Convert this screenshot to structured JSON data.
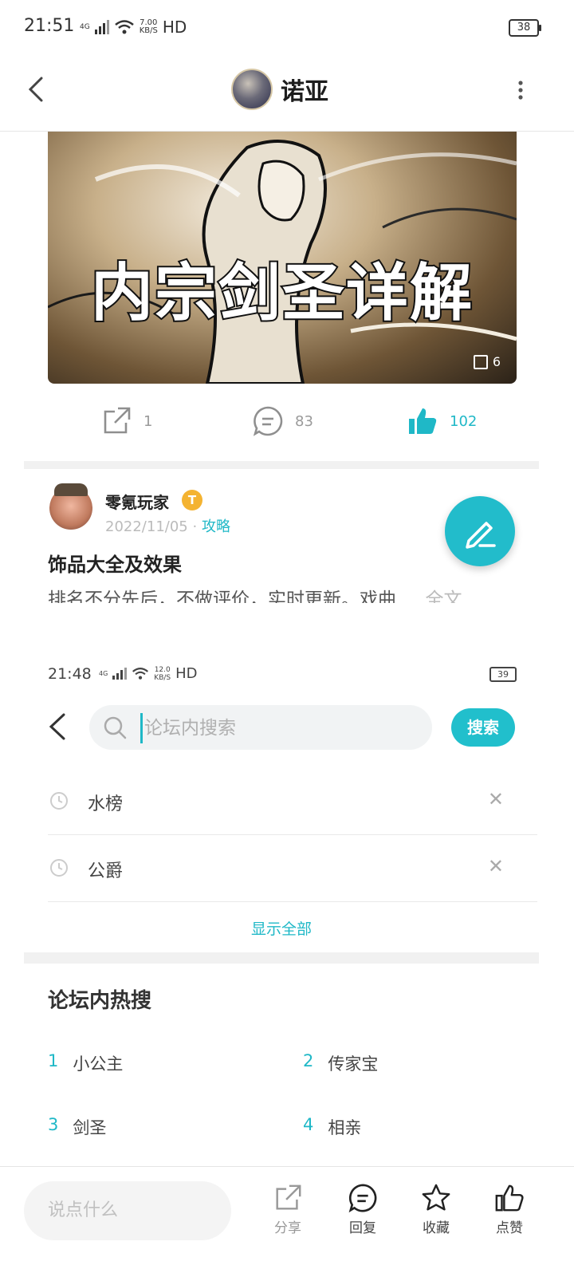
{
  "status_bar": {
    "time": "21:51",
    "network": "4G",
    "speed_value": "7.00",
    "speed_unit": "KB/S",
    "hd": "HD",
    "battery": "38"
  },
  "header": {
    "title": "诺亚"
  },
  "banner": {
    "title": "内宗剑圣详解",
    "image_count": "6"
  },
  "actions": {
    "share_count": "1",
    "comment_count": "83",
    "like_count": "102"
  },
  "post": {
    "author": "零氪玩家",
    "badge": "T",
    "date": "2022/11/05",
    "separator": "·",
    "tag": "攻略",
    "title": "饰品大全及效果",
    "excerpt": "排名不分先后，不做评价，实时更新。戏曲",
    "more": "... 全文"
  },
  "embedded_screen": {
    "time": "21:48",
    "network": "4G",
    "speed_value": "12.0",
    "speed_unit": "KB/S",
    "hd": "HD",
    "battery": "39",
    "search_placeholder": "论坛内搜索",
    "search_button": "搜索",
    "history": [
      {
        "label": "水榜"
      },
      {
        "label": "公爵"
      }
    ],
    "show_all": "显示全部",
    "hot_title": "论坛内热搜",
    "hot": [
      {
        "rank": "1",
        "label": "小公主"
      },
      {
        "rank": "2",
        "label": "传家宝"
      },
      {
        "rank": "3",
        "label": "剑圣"
      },
      {
        "rank": "4",
        "label": "相亲"
      }
    ]
  },
  "bottom_bar": {
    "comment_placeholder": "说点什么",
    "share": "分享",
    "reply": "回复",
    "collect": "收藏",
    "like": "点赞"
  },
  "colors": {
    "accent": "#1fb8c7",
    "badge": "#f4b331"
  }
}
